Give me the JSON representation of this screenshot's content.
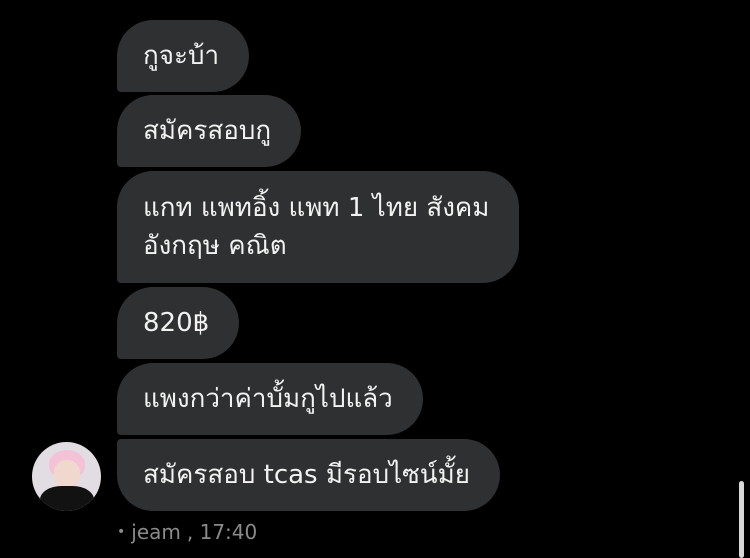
{
  "messages": [
    {
      "text": "กูจะบ้า"
    },
    {
      "text": "สมัครสอบกู"
    },
    {
      "text": "แกท แพทอิ้ง แพท 1 ไทย สังคม\nอังกฤษ คณิต"
    },
    {
      "text": "820฿"
    },
    {
      "text": "แพงกว่าค่าบั้มกูไปแล้ว"
    },
    {
      "text": "สมัครสอบ tcas มีรอบไซน์มั้ย"
    }
  ],
  "meta": {
    "bullet": "•",
    "sender": "jeam",
    "time": ", 17:40"
  },
  "colors": {
    "background": "#000000",
    "bubble": "#2f3031",
    "text": "#f2f2f2",
    "meta": "#8a8a8a"
  }
}
